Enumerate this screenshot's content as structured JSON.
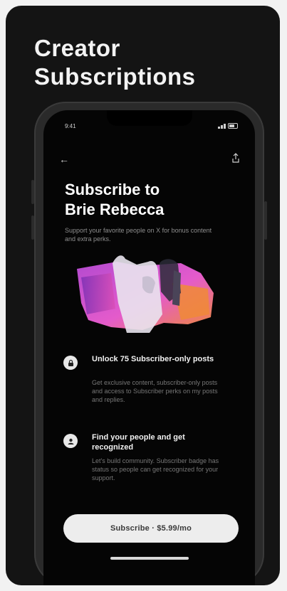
{
  "headline": {
    "line1": "Creator",
    "line2": "Subscriptions"
  },
  "phone": {
    "status": {
      "time": "9:41"
    },
    "screen": {
      "title_line1": "Subscribe to",
      "title_line2": "Brie Rebecca",
      "subtitle": "Support your favorite people on X for bonus content and extra perks.",
      "features": [
        {
          "icon": "lock-icon",
          "title": "Unlock 75 Subscriber-only posts",
          "description": "Get exclusive content, subscriber-only posts and access to Subscriber perks on my posts and replies."
        },
        {
          "icon": "badge-icon",
          "title": "Find your people and get recognized",
          "description": "Let's build community. Subscriber badge has status so people can get recognized for your support."
        }
      ],
      "cta_label": "Subscribe · $5.99/mo"
    }
  },
  "colors": {
    "background": "#141414",
    "accent_pink": "#e45bcb",
    "accent_orange": "#f08a37"
  }
}
